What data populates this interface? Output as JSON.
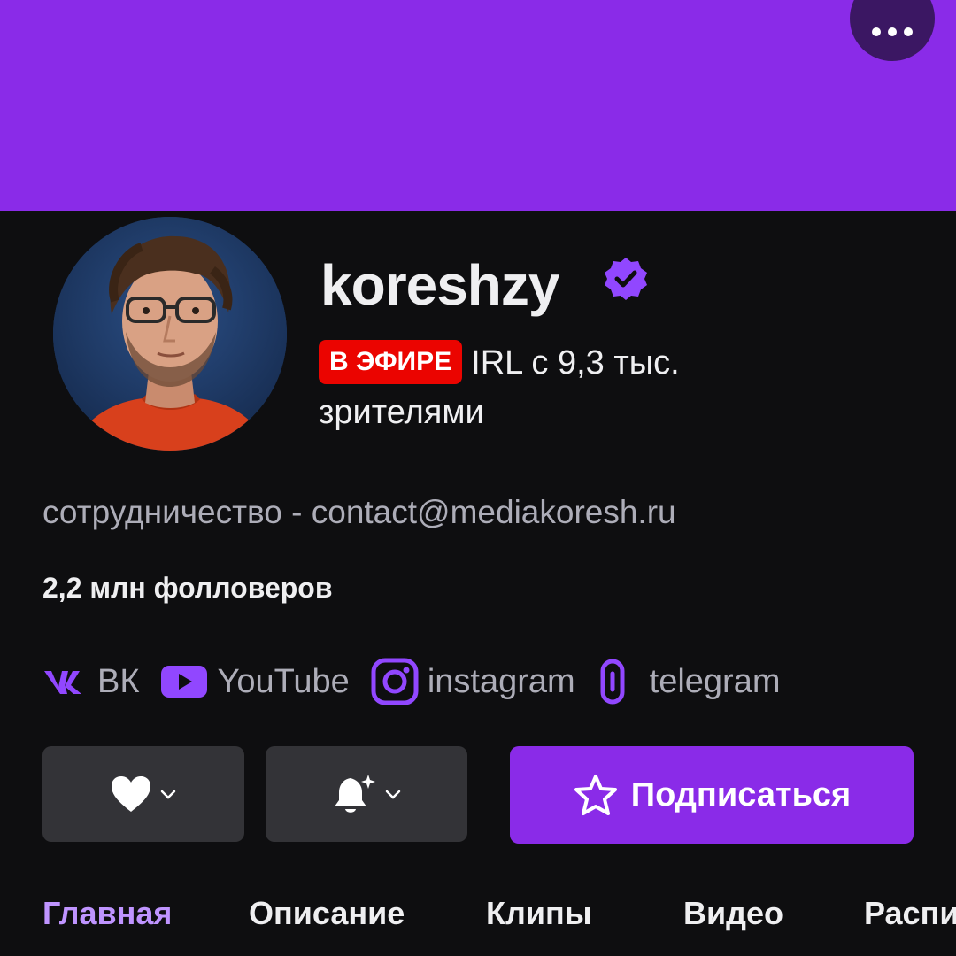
{
  "header": {
    "more_icon": "ellipsis-icon",
    "banner_color": "#8a2be8"
  },
  "channel": {
    "name": "koreshzy",
    "verified_icon": "verified-badge-icon",
    "live_badge": "В ЭФИРЕ",
    "live_status": "IRL с 9,3 тыс. зрителями",
    "bio": "сотрудничество - contact@mediakoresh.ru",
    "followers": "2,2 млн фолловеров"
  },
  "socials": [
    {
      "icon": "vk-icon",
      "label": "ВК"
    },
    {
      "icon": "youtube-icon",
      "label": "YouTube"
    },
    {
      "icon": "instagram-icon",
      "label": "instagram"
    },
    {
      "icon": "telegram-link-icon",
      "label": "telegram"
    }
  ],
  "actions": {
    "follow_icon": "heart-icon",
    "notify_icon": "bell-icon",
    "subscribe_icon": "star-icon",
    "subscribe_label": "Подписаться"
  },
  "tabs": [
    {
      "label": "Главная",
      "active": true
    },
    {
      "label": "Описание",
      "active": false
    },
    {
      "label": "Клипы",
      "active": false
    },
    {
      "label": "Видео",
      "active": false
    },
    {
      "label": "Расписание",
      "active": false
    }
  ],
  "colors": {
    "accent": "#8a2be8",
    "accent_light": "#bf94ff",
    "live": "#eb0400",
    "background": "#0e0e10",
    "button_gray": "#333337"
  }
}
